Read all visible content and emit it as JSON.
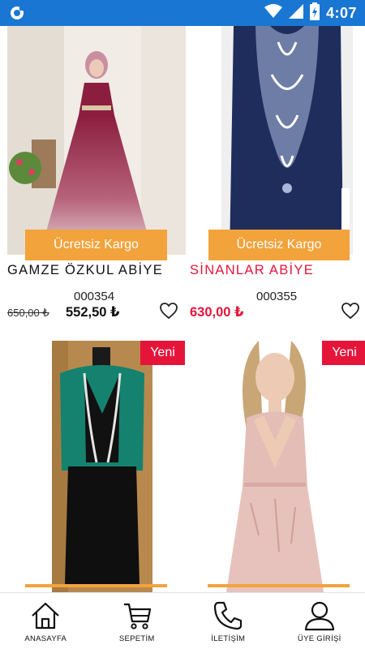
{
  "status_bar": {
    "time": "4:07",
    "app_icon": "notification-icon",
    "icons": [
      "wifi-icon",
      "signal-icon",
      "battery-charging-icon"
    ]
  },
  "products": [
    {
      "name": "GAMZE ÖZKUL ABİYE",
      "code": "000354",
      "old_price": "650,00 ₺",
      "price": "552,50 ₺",
      "badge": "Ücretsiz Kargo",
      "name_color": "#111111",
      "price_color": "#111111"
    },
    {
      "name": "SİNANLAR ABİYE",
      "code": "000355",
      "old_price": "",
      "price": "630,00 ₺",
      "badge": "Ücretsiz Kargo",
      "name_color": "#e5153a",
      "price_color": "#e5153a"
    },
    {
      "badge_new": "Yeni"
    },
    {
      "badge_new": "Yeni"
    }
  ],
  "bottom_nav": [
    {
      "label": "ANASAYFA",
      "icon": "home-icon"
    },
    {
      "label": "SEPETİM",
      "icon": "cart-icon"
    },
    {
      "label": "İLETİŞİM",
      "icon": "phone-icon"
    },
    {
      "label": "ÜYE GİRİŞİ",
      "icon": "user-icon"
    }
  ],
  "colors": {
    "status_bar": "#1976d2",
    "cargo_badge": "#f2a33c",
    "new_badge": "#e5153a",
    "accent_red": "#e5153a"
  }
}
